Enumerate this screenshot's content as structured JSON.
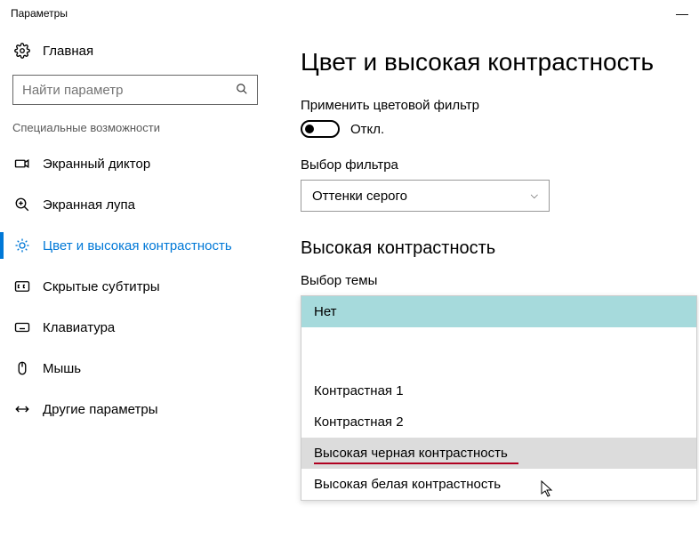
{
  "titlebar": {
    "title": "Параметры"
  },
  "sidebar": {
    "home_label": "Главная",
    "search_placeholder": "Найти параметр",
    "section_title": "Специальные возможности",
    "items": [
      {
        "label": "Экранный диктор"
      },
      {
        "label": "Экранная лупа"
      },
      {
        "label": "Цвет и высокая контрастность"
      },
      {
        "label": "Скрытые субтитры"
      },
      {
        "label": "Клавиатура"
      },
      {
        "label": "Мышь"
      },
      {
        "label": "Другие параметры"
      }
    ]
  },
  "main": {
    "heading": "Цвет и высокая контрастность",
    "filter_apply_label": "Применить цветовой фильтр",
    "filter_toggle_state": "Откл.",
    "filter_select_label": "Выбор фильтра",
    "filter_select_value": "Оттенки серого",
    "contrast_heading": "Высокая контрастность",
    "theme_select_label": "Выбор темы",
    "theme_options": [
      "Нет",
      "Контрастная 1",
      "Контрастная 2",
      "Высокая черная контрастность",
      "Высокая белая контрастность"
    ]
  }
}
